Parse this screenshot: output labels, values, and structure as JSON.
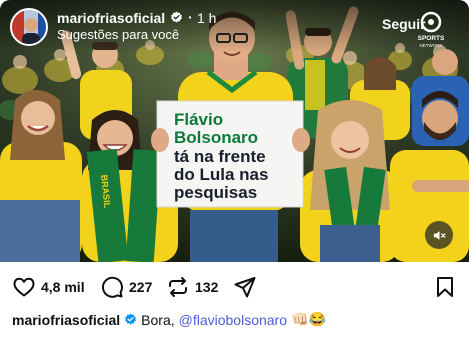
{
  "post": {
    "username": "mariofriasoficial",
    "separator": "·",
    "time": "1 h",
    "subtitle": "Sugestões para você",
    "follow_label": "Seguir"
  },
  "network_logo": {
    "text_top": "SPORTS",
    "text_bottom": "NETWORK"
  },
  "sign": {
    "name_line1": "Flávio",
    "name_line2": "Bolsonaro",
    "body_line1": "tá na frente",
    "body_line2": "do Lula nas",
    "body_line3": "pesquisas"
  },
  "actions": {
    "likes": "4,8 mil",
    "comments": "227",
    "reposts": "132"
  },
  "caption": {
    "username": "mariofriasoficial",
    "text": "Bora,",
    "mention": "@flaviobolsonaro",
    "emoji": "👊🏻😂"
  },
  "colors": {
    "brasil_yellow": "#f2d21a",
    "brasil_green": "#1f8a3b",
    "sign_green": "#0e7a3a",
    "sign_dark": "#1a1f2b",
    "mention_blue": "#4a5fd9",
    "verified_blue": "#0095f6"
  },
  "icons": [
    "heart-icon",
    "comment-icon",
    "repost-icon",
    "share-icon",
    "bookmark-icon",
    "muted-speaker-icon",
    "verified-badge-icon"
  ]
}
